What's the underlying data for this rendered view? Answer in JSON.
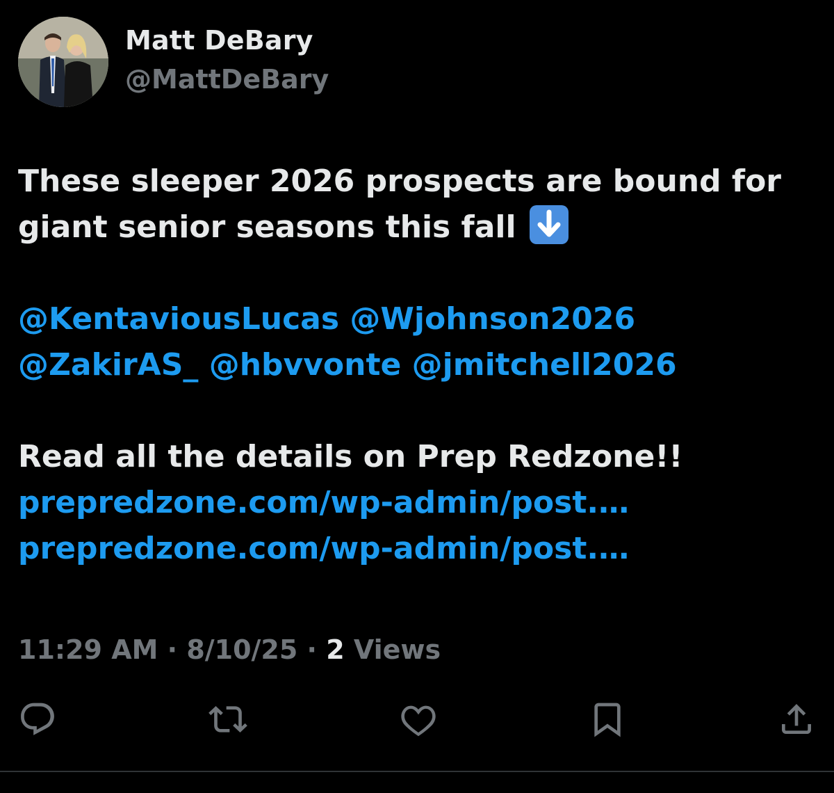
{
  "author": {
    "display_name": "Matt DeBary",
    "handle": "@MattDeBary"
  },
  "tweet": {
    "line1": "These sleeper 2026 prospects are bound for",
    "line2": "giant senior seasons this fall",
    "emoji": "down-arrow-emoji",
    "mentions": [
      "@KentaviousLucas",
      "@Wjohnson2026",
      "@ZakirAS_",
      "@hbvvonte",
      "@jmitchell2026"
    ],
    "cta": "Read all the details on Prep Redzone!!",
    "links": [
      "prepredzone.com/wp-admin/post.…",
      "prepredzone.com/wp-admin/post.…"
    ]
  },
  "meta": {
    "time": "11:29 AM",
    "date": "8/10/25",
    "views_count": "2",
    "views_label": "Views",
    "separator": "·"
  },
  "actions": {
    "icons": [
      "reply-icon",
      "retweet-icon",
      "like-icon",
      "bookmark-icon",
      "share-icon"
    ]
  },
  "colors": {
    "background": "#000000",
    "text": "#e7e9ea",
    "secondary": "#71767b",
    "link": "#1d9bf0"
  }
}
